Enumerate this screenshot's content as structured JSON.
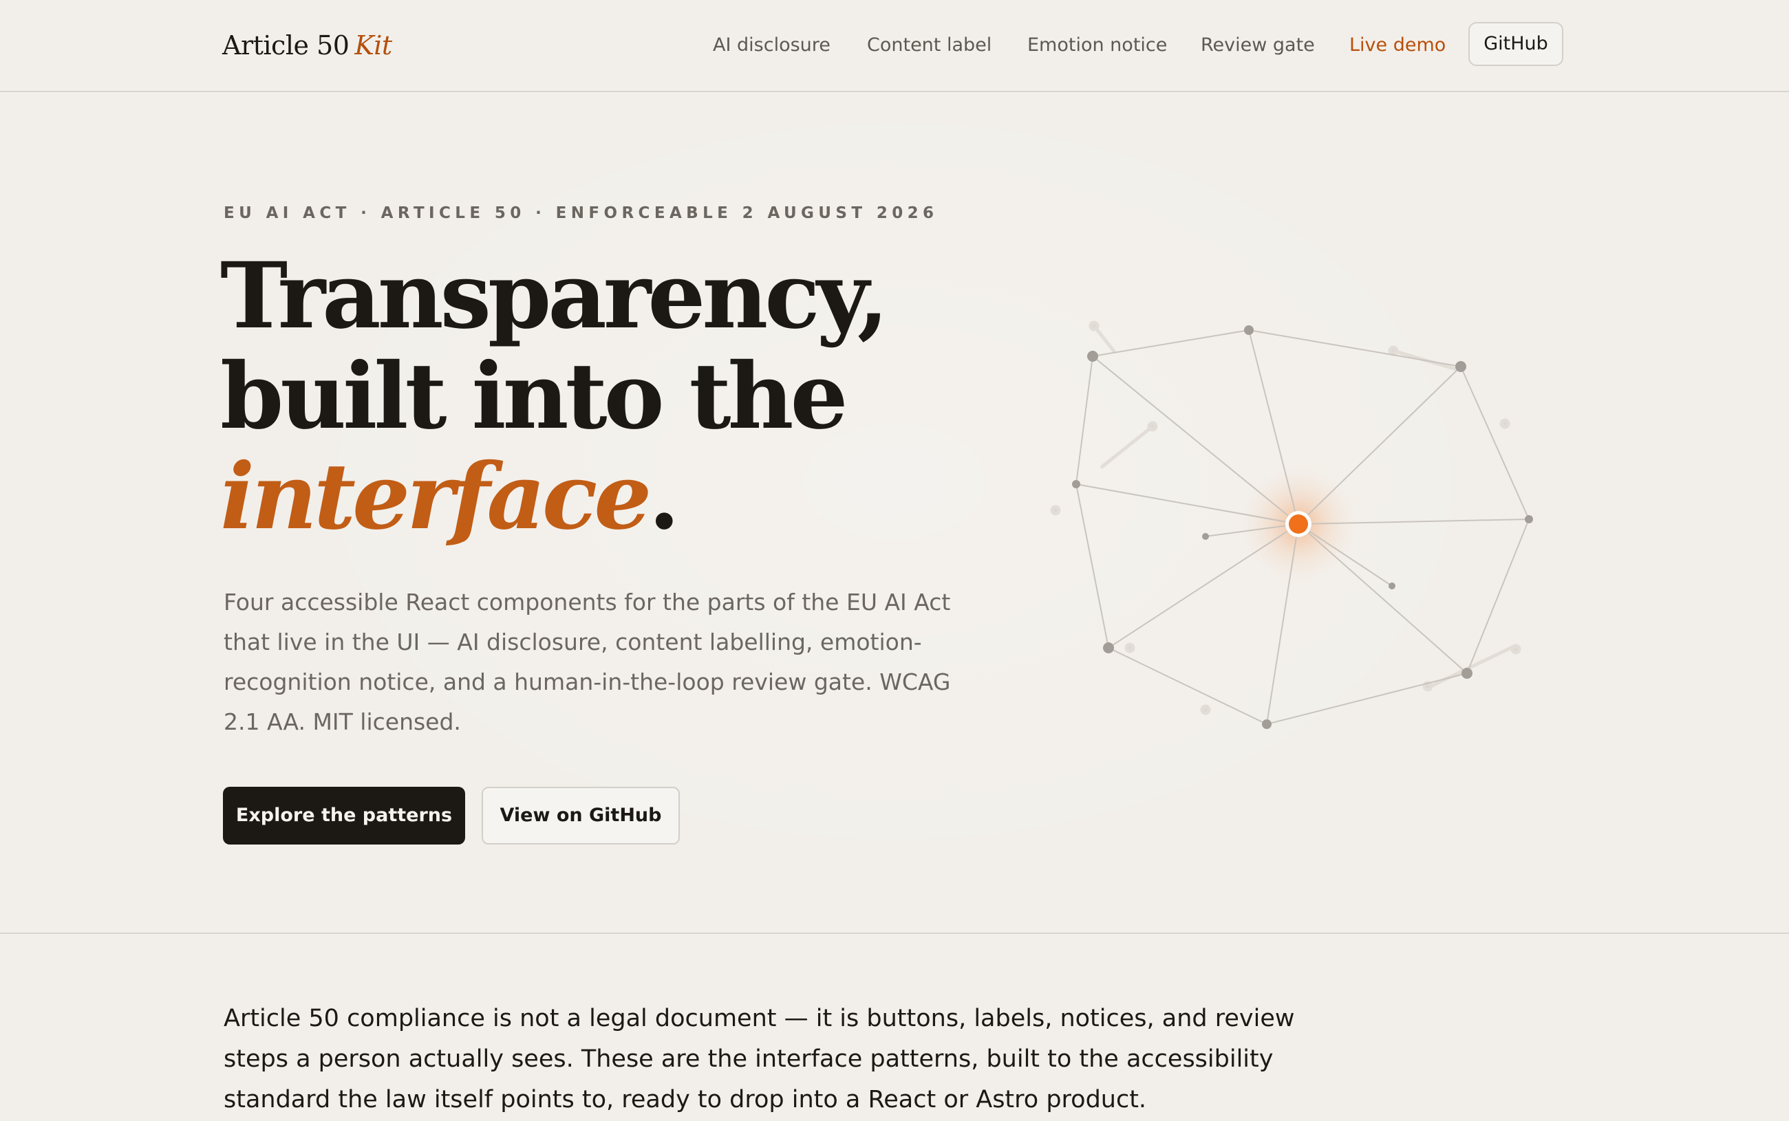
{
  "nav": {
    "logo_text": "Article 50",
    "logo_accent": "Kit",
    "links": [
      "AI disclosure",
      "Content label",
      "Emotion notice",
      "Review gate",
      "Live demo"
    ],
    "github_label": "GitHub"
  },
  "hero": {
    "eyebrow": "EU AI ACT · ARTICLE 50 · ENFORCEABLE 2 AUGUST 2026",
    "title_line1": "Transparency,",
    "title_line2": "built into the",
    "title_accent": "interface",
    "title_period": ".",
    "lede": "Four accessible React components for the parts of the EU AI Act that live in the UI — AI disclosure, content labelling, emotion-recognition notice, and a human-in-the-loop review gate. WCAG 2.1 AA. MIT licensed.",
    "primary_cta": "Explore the patterns",
    "secondary_cta": "View on GitHub"
  },
  "intro": {
    "text": "Article 50 compliance is not a legal document — it is buttons, labels, notices, and review steps a person actually sees. These are the interface patterns, built to the accessibility standard the law itself points to, ready to drop into a React or Astro product."
  },
  "colors": {
    "background": "#f2efea",
    "text": "#1c1915",
    "muted": "#6b6660",
    "accent": "#c25d16",
    "live_link": "#b8500b",
    "network_hub": "#f0701c"
  },
  "graphic": {
    "icon": "network-graph-icon"
  }
}
